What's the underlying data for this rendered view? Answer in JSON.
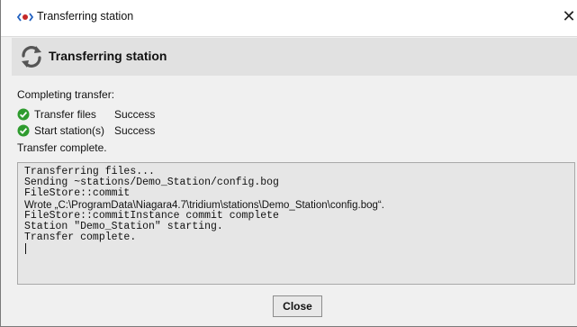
{
  "window": {
    "title": "Transferring station"
  },
  "header": {
    "title": "Transferring station"
  },
  "progress": {
    "section_label": "Completing transfer:",
    "steps": [
      {
        "name": "Transfer files",
        "status": "Success"
      },
      {
        "name": "Start station(s)",
        "status": "Success"
      }
    ],
    "complete_label": "Transfer complete."
  },
  "log": {
    "lines": [
      "Transferring files...",
      "Sending ~stations/Demo_Station/config.bog",
      "FileStore::commit",
      "Wrote „C:\\ProgramData\\Niagara4.7\\tridium\\stations\\Demo_Station\\config.bog“.",
      "FileStore::commitInstance commit complete",
      "Station \"Demo_Station\" starting.",
      "Transfer complete."
    ]
  },
  "footer": {
    "close_label": "Close"
  },
  "colors": {
    "success": "#2e9b2e",
    "header_band": "#e1e1e1",
    "log_bg": "#e6e6e6"
  },
  "icons": {
    "app": "niagara-logo-icon",
    "header": "sync-icon",
    "step": "check-circle-icon",
    "close": "close-icon"
  }
}
